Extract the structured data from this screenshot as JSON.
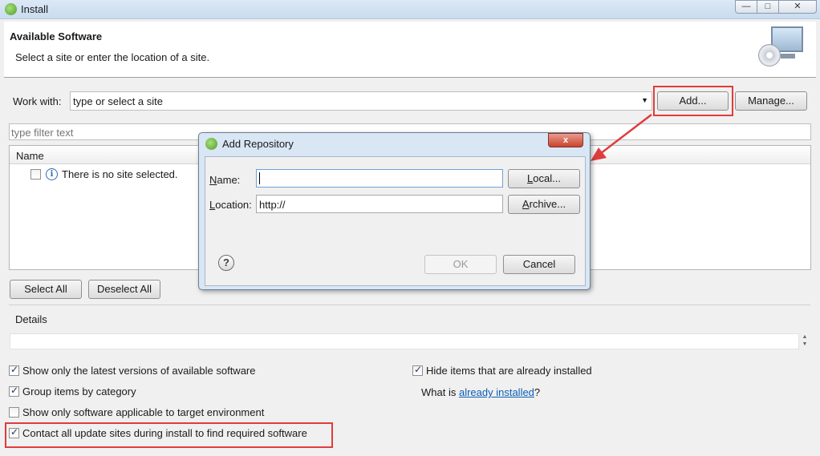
{
  "window": {
    "title": "Install",
    "minimize_glyph": "—",
    "maximize_glyph": "□",
    "close_glyph": "✕"
  },
  "header": {
    "title": "Available Software",
    "subtitle": "Select a site or enter the location of a site."
  },
  "work_with": {
    "label": "Work with:",
    "value": "type or select a site",
    "add_label": "Add...",
    "manage_label": "Manage..."
  },
  "filter": {
    "placeholder": "type filter text"
  },
  "tree": {
    "column_name": "Name",
    "empty_row": "There is no site selected.",
    "info_glyph": "i"
  },
  "buttons": {
    "select_all": "Select All",
    "deselect_all": "Deselect All"
  },
  "details": {
    "label": "Details"
  },
  "options": {
    "latest_versions": "Show only the latest versions of available software",
    "group_by_category": "Group items by category",
    "target_env": "Show only software applicable to target environment",
    "contact_sites": "Contact all update sites during install to find required software",
    "hide_installed": "Hide items that are already installed",
    "what_is_prefix": "What is ",
    "already_installed_link": "already installed",
    "what_is_suffix": "?"
  },
  "dialog": {
    "title": "Add Repository",
    "close_glyph": "x",
    "name_label_u": "N",
    "name_label_rest": "ame:",
    "name_value": "",
    "location_label_u": "L",
    "location_label_rest": "ocation:",
    "location_value": "http://",
    "local_label_u": "L",
    "local_label_rest": "ocal...",
    "archive_label_u": "A",
    "archive_label_rest": "rchive...",
    "ok_label": "OK",
    "cancel_label": "Cancel",
    "help_glyph": "?"
  },
  "colors": {
    "highlight": "#e03c3c",
    "link": "#0b5eb8",
    "titlebar": "#c9dcef"
  }
}
